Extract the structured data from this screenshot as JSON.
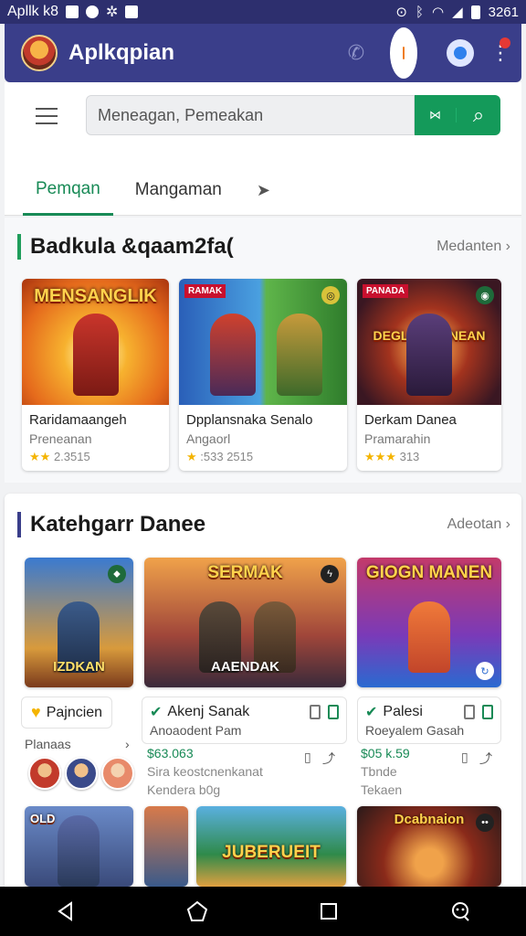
{
  "status_bar": {
    "left_text": "Apllk k8",
    "time": "3261",
    "icons": [
      "notification-square-icon",
      "chat-bubble-icon",
      "gear-icon",
      "image-icon",
      "nfc-icon",
      "bluetooth-icon",
      "wifi-icon",
      "signal-icon",
      "battery-icon"
    ]
  },
  "app_bar": {
    "title": "Aplkqpian",
    "actions": [
      "phone-icon",
      "tablet-icon",
      "chat-icon",
      "more-vertical-icon"
    ]
  },
  "search": {
    "placeholder": "Meneagan, Pemeakan",
    "scan_label": "⋈",
    "search_icon": "search-icon"
  },
  "tabs": [
    {
      "label": "Pemqan",
      "active": true
    },
    {
      "label": "Mangaman",
      "active": false
    }
  ],
  "section1": {
    "title": "Badkula &qaam2fa(",
    "more_label": "Medanten ›",
    "accent": "#1f9d5c",
    "cards": [
      {
        "banner": "MENSANGLIK",
        "name": "Raridamaangeh",
        "sub": "Preneanan",
        "rating": "2.3515",
        "stars": "★★"
      },
      {
        "banner": "",
        "tag": "RAMAK",
        "name": "Dpplansnaka Senalo",
        "sub": "Angaorl",
        "rating": ":533 2515",
        "stars": "★"
      },
      {
        "banner": "DEGLAN RANEAN",
        "tag": "PANADA",
        "name": "Derkam Danea",
        "sub": "Pramarahin",
        "rating": "313",
        "stars": "★★★"
      }
    ]
  },
  "section2": {
    "title": "Katehgarr Danee",
    "more_label": "Adeotan ›",
    "accent": "#3a3e8a",
    "tiles": [
      {
        "banner": "",
        "lower": "IZDKAN"
      },
      {
        "banner": "SERMAK",
        "lower": "AAENDAK"
      },
      {
        "banner": "GIOGN MANEN",
        "lower": ""
      }
    ],
    "col1": {
      "pill": "Pajncien",
      "label": "Planaas",
      "arrow": "›"
    },
    "col2": {
      "title": "Akenj Sanak",
      "sub": "Anoaodent Pam",
      "price": "$63.063",
      "line1": "Sira keostcnenkanat",
      "line2": "Kendera b0g"
    },
    "col3": {
      "title": "Palesi",
      "sub": "Roeyalem Gasah",
      "price": "$05 k.59",
      "line1": "Tbnde",
      "line2": "Tekaen"
    },
    "bottom_tiles": [
      {
        "banner": "OLD"
      },
      {
        "banner": "JUBERUEIT"
      },
      {
        "banner": "Dcabnaion"
      }
    ]
  },
  "nav": [
    "back-icon",
    "home-icon",
    "recents-icon",
    "assistant-icon"
  ]
}
